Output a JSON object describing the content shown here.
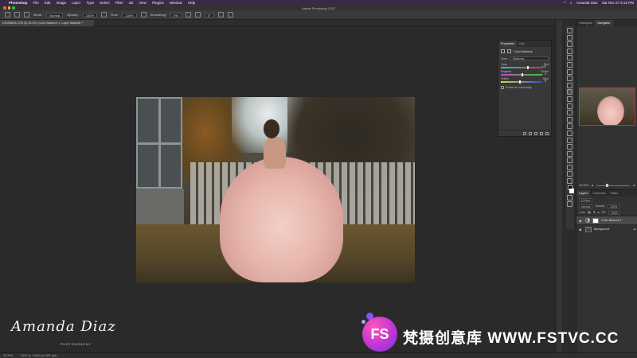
{
  "menubar": {
    "app": "Photoshop",
    "items": [
      "File",
      "Edit",
      "Image",
      "Layer",
      "Type",
      "Select",
      "Filter",
      "3D",
      "View",
      "Plugins",
      "Window",
      "Help"
    ],
    "user": "Amanda Diaz",
    "datetime": "Sat Nov 27  8:13 PM"
  },
  "titlebar": {
    "title": "Adobe Photoshop 2022"
  },
  "options": {
    "mode_label": "Mode:",
    "mode_value": "Normal",
    "opacity_label": "Opacity:",
    "opacity_value": "100%",
    "flow_label": "Flow:",
    "flow_value": "100%",
    "smoothing_label": "Smoothing:",
    "smoothing_value": "0%",
    "angle_value": "0°"
  },
  "document": {
    "tab_label": "DIHA5628.CR3 @ 33.3% (Color Balance 1, Layer Mask/8) *"
  },
  "properties": {
    "tab_active": "Properties",
    "tab_other": "Info",
    "title": "Color Balance",
    "tone_label": "Tone:",
    "tone_value": "Midtones",
    "sliders": [
      {
        "left": "Cyan",
        "right": "Red",
        "value": "+27",
        "pos": 0.63,
        "gradient": "linear-gradient(90deg,#19c8c8,#d33)"
      },
      {
        "left": "Magenta",
        "right": "Green",
        "value": "0",
        "pos": 0.5,
        "gradient": "linear-gradient(90deg,#d43bd4,#3c3)"
      },
      {
        "left": "Yellow",
        "right": "Blue",
        "value": "-9",
        "pos": 0.45,
        "gradient": "linear-gradient(90deg,#dd3,#34d)"
      }
    ],
    "preserve_label": "Preserve Luminosity"
  },
  "right_tabs": {
    "histogram": "Histogram",
    "navigator": "Navigator"
  },
  "navigator": {
    "zoom": "33.33%"
  },
  "layers": {
    "tabs": [
      "Layers",
      "Channels",
      "Paths"
    ],
    "kind": "Q Kind",
    "blend": "Normal",
    "opacity_label": "Opacity:",
    "opacity_value": "100%",
    "lock_label": "Lock:",
    "fill_label": "Fill:",
    "fill_value": "100%",
    "items": [
      {
        "name": "Color Balance 1",
        "selected": true
      },
      {
        "name": "Background",
        "selected": false
      }
    ]
  },
  "statusbar": {
    "zoom": "33.33%",
    "doc_info": "8192 px x 5464 px (300 ppi)"
  },
  "watermark": {
    "signature": "Amanda Diaz",
    "signature_sub": "PHOTOGRAPHY",
    "logo_letters": "FS",
    "site_text": "梵摄创意库 WWW.FSTVC.CC"
  }
}
